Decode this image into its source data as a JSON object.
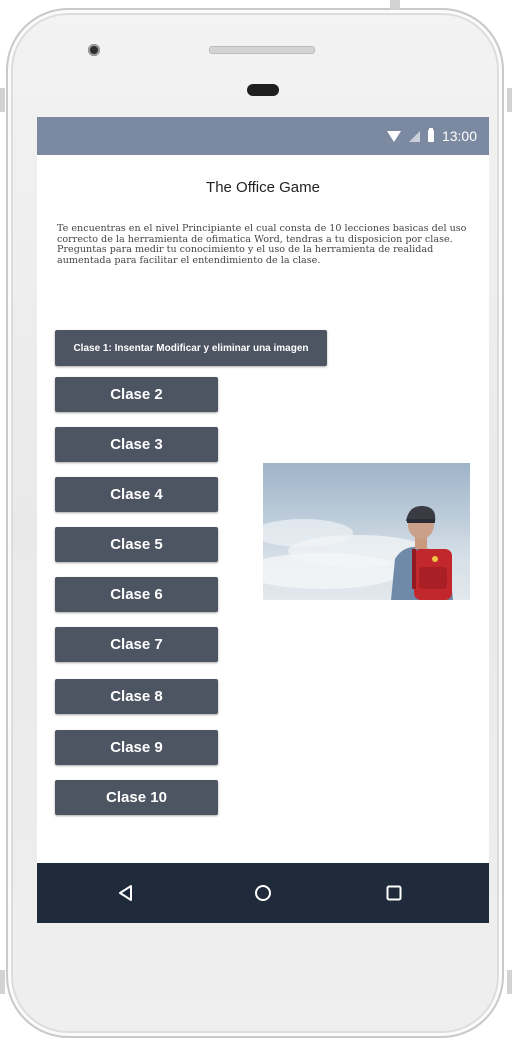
{
  "status_bar": {
    "time": "13:00",
    "icons": [
      "wifi-icon",
      "signal-icon",
      "battery-icon"
    ]
  },
  "app": {
    "title": "The Office Game",
    "intro": "Te encuentras en el nivel Principiante el cual consta de 10 lecciones basicas del uso correcto de la herramienta de ofimatica Word, tendras a tu disposicion por clase. Preguntas para medir tu conocimiento y el uso de la herramienta de realidad aumentada para facilitar el entendimiento de la clase."
  },
  "classes": {
    "class1": "Clase 1: Insentar Modificar y eliminar una imagen",
    "class2": "Clase 2",
    "class3": "Clase 3",
    "class4": "Clase 4",
    "class5": "Clase 5",
    "class6": "Clase 6",
    "class7": "Clase 7",
    "class8": "Clase 8",
    "class9": "Clase 9",
    "class10": "Clase 10"
  },
  "nav_bar": {
    "icons": [
      "back-icon",
      "home-icon",
      "recent-apps-icon"
    ]
  },
  "colors": {
    "status_bar": "#7c8aa1",
    "button": "#4d5563",
    "nav_bar": "#1f2b3a"
  }
}
